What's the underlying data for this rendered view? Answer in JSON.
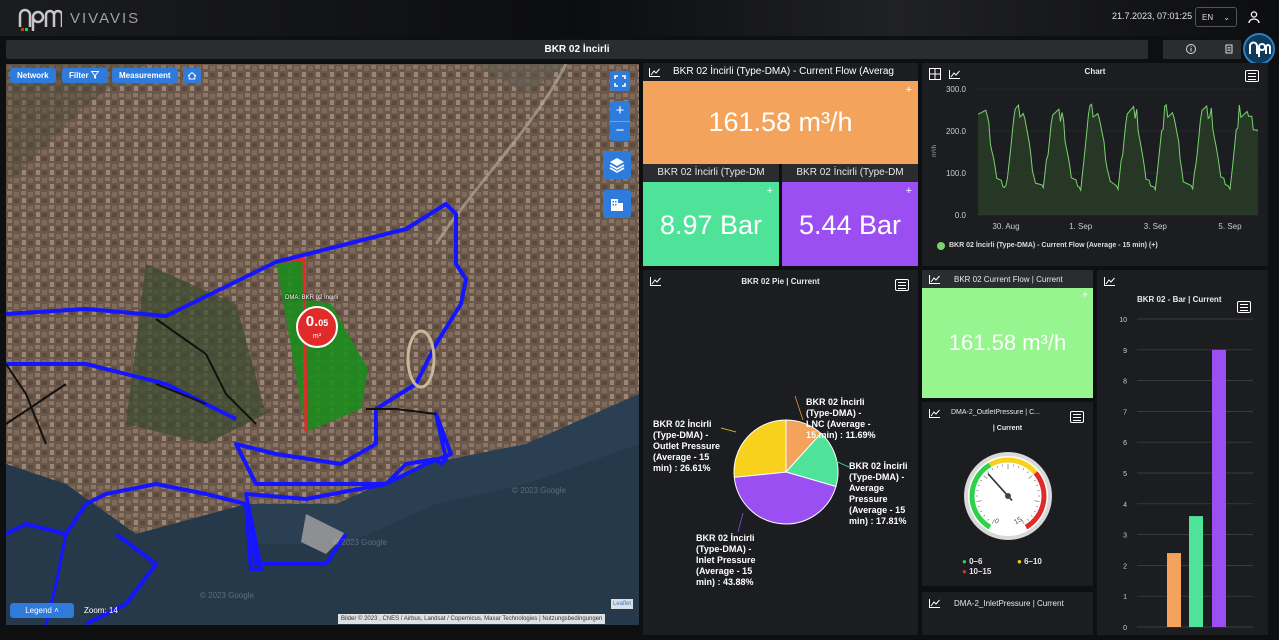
{
  "app": {
    "logo_text": "VIVAVIS",
    "datetime": "21.7.2023, 07:01:25",
    "language": "EN"
  },
  "page_title": "BKR 02 İncirli",
  "map": {
    "buttons": {
      "network": "Network",
      "filter": "Filter",
      "measurement": "Measurement"
    },
    "dma_label": "DMA: BKR 02 İncirli",
    "dma_value_main": "0.",
    "dma_value_sub": "05",
    "dma_unit": "m³",
    "legend": "Legend",
    "zoom": "Zoom: 14",
    "attribution": "Bilder © 2023 , CNES / Airbus, Landsat / Copernicus, Maxar Technologies",
    "terms": "Nutzungsbedingungen",
    "leaflet": "Leaflet",
    "watermark": "© 2023 Google"
  },
  "tiles": {
    "flow": {
      "title": "BKR 02 İncirli (Type-DMA) - Current Flow (Averag",
      "value": "161.58 m³/h",
      "color": "#f3a35b"
    },
    "outlet": {
      "title": "BKR 02 İncirli (Type-DM",
      "value": "8.97 Bar",
      "color": "#4fe39a"
    },
    "inlet": {
      "title": "BKR 02 İncirli (Type-DM",
      "value": "5.44 Bar",
      "color": "#9b4ff2"
    },
    "current_flow": {
      "title": "BKR 02 Current Flow | Current",
      "value": "161.58 m³/h",
      "color": "#96f58f"
    },
    "gauge": {
      "title": "DMA-2_OutletPressure | C...",
      "subtitle": "| Current",
      "min_label": "0",
      "max_label": "15",
      "legend": [
        "0–6",
        "6–10",
        "10–15"
      ]
    },
    "inlet_pressure": {
      "title": "DMA-2_InletPressure | Current"
    }
  },
  "line_chart": {
    "title": "Chart",
    "ylabel": "m³/h",
    "yticks": [
      "300.0",
      "200.0",
      "100.0",
      "0.0"
    ],
    "xticks": [
      "30. Aug",
      "1. Sep",
      "3. Sep",
      "5. Sep"
    ],
    "legend": "BKR 02 İncirli (Type-DMA) - Current Flow (Average - 15 min) (+)"
  },
  "pie": {
    "title": "BKR 02 Pie | Current",
    "labels": [
      "BKR 02 İncirli (Type-DMA) - LNC (Average - 15 min) : 11.69%",
      "BKR 02 İncirli (Type-DMA) - Average Pressure (Average - 15 min) : 17.81%",
      "BKR 02 İncirli (Type-DMA) - Inlet Pressure (Average - 15 min) : 43.88%",
      "BKR 02 İncirli (Type-DMA) - Outlet Pressure (Average - 15 min) : 26.61%"
    ]
  },
  "bar": {
    "title": "BKR 02 - Bar | Current",
    "yticks": [
      "10",
      "9",
      "8",
      "7",
      "6",
      "5",
      "4",
      "3",
      "2",
      "1",
      "0"
    ]
  },
  "colors": {
    "accent": "#2f7bdc",
    "panel": "#1c1d20",
    "dma_blue": "#1515ff",
    "dma_red": "#e02b2b",
    "green": "#4fe39a",
    "purple": "#9b4ff2",
    "orange": "#f3a35b",
    "yellow": "#f7d11b"
  },
  "chart_data": [
    {
      "type": "line",
      "title": "Chart",
      "ylabel": "m³/h",
      "ylim": [
        0,
        300
      ],
      "x_range": [
        "29. Aug",
        "6. Sep"
      ],
      "series": [
        {
          "name": "BKR 02 İncirli (Type-DMA) - Current Flow (Average - 15 min) (+)",
          "color": "#7ad26f",
          "x": [
            "29. Aug 12:00",
            "29. Aug 18:00",
            "30. Aug 00:00",
            "30. Aug 06:00",
            "30. Aug 12:00",
            "30. Aug 18:00",
            "31. Aug 00:00",
            "31. Aug 06:00",
            "31. Aug 12:00",
            "31. Aug 18:00",
            "1. Sep 00:00",
            "1. Sep 06:00",
            "1. Sep 12:00",
            "1. Sep 18:00",
            "2. Sep 00:00",
            "2. Sep 06:00",
            "2. Sep 12:00",
            "2. Sep 18:00",
            "3. Sep 00:00",
            "3. Sep 06:00",
            "3. Sep 12:00",
            "3. Sep 18:00",
            "4. Sep 00:00",
            "4. Sep 06:00",
            "4. Sep 12:00",
            "4. Sep 18:00",
            "5. Sep 00:00",
            "5. Sep 06:00",
            "5. Sep 12:00",
            "5. Sep 18:00",
            "6. Sep 00:00"
          ],
          "values": [
            255,
            230,
            90,
            65,
            250,
            240,
            85,
            65,
            250,
            235,
            90,
            65,
            255,
            235,
            90,
            60,
            250,
            240,
            85,
            65,
            250,
            235,
            85,
            60,
            255,
            240,
            90,
            65,
            250,
            235,
            200
          ]
        }
      ]
    },
    {
      "type": "pie",
      "title": "BKR 02 Pie | Current",
      "series": [
        {
          "name": "BKR 02 İncirli (Type-DMA) - LNC (Average - 15 min)",
          "value": 11.69,
          "color": "#f3a35b"
        },
        {
          "name": "BKR 02 İncirli (Type-DMA) - Average Pressure (Average - 15 min)",
          "value": 17.81,
          "color": "#4fe39a"
        },
        {
          "name": "BKR 02 İncirli (Type-DMA) - Inlet Pressure (Average - 15 min)",
          "value": 43.88,
          "color": "#9b4ff2"
        },
        {
          "name": "BKR 02 İncirli (Type-DMA) - Outlet Pressure (Average - 15 min)",
          "value": 26.61,
          "color": "#f7d11b"
        }
      ]
    },
    {
      "type": "bar",
      "title": "BKR 02 - Bar | Current",
      "ylim": [
        0,
        10
      ],
      "values": [
        2.4,
        3.6,
        9.0
      ],
      "colors": [
        "#f3a35b",
        "#4fe39a",
        "#9b4ff2"
      ]
    },
    {
      "type": "gauge",
      "title": "DMA-2_OutletPressure | C...",
      "range": [
        0,
        15
      ],
      "value": 5.4,
      "bands": [
        {
          "label": "0–6",
          "from": 0,
          "to": 6,
          "color": "#2fd14a"
        },
        {
          "label": "6–10",
          "from": 6,
          "to": 10,
          "color": "#f7d11b"
        },
        {
          "label": "10–15",
          "from": 10,
          "to": 15,
          "color": "#e02b2b"
        }
      ]
    }
  ]
}
